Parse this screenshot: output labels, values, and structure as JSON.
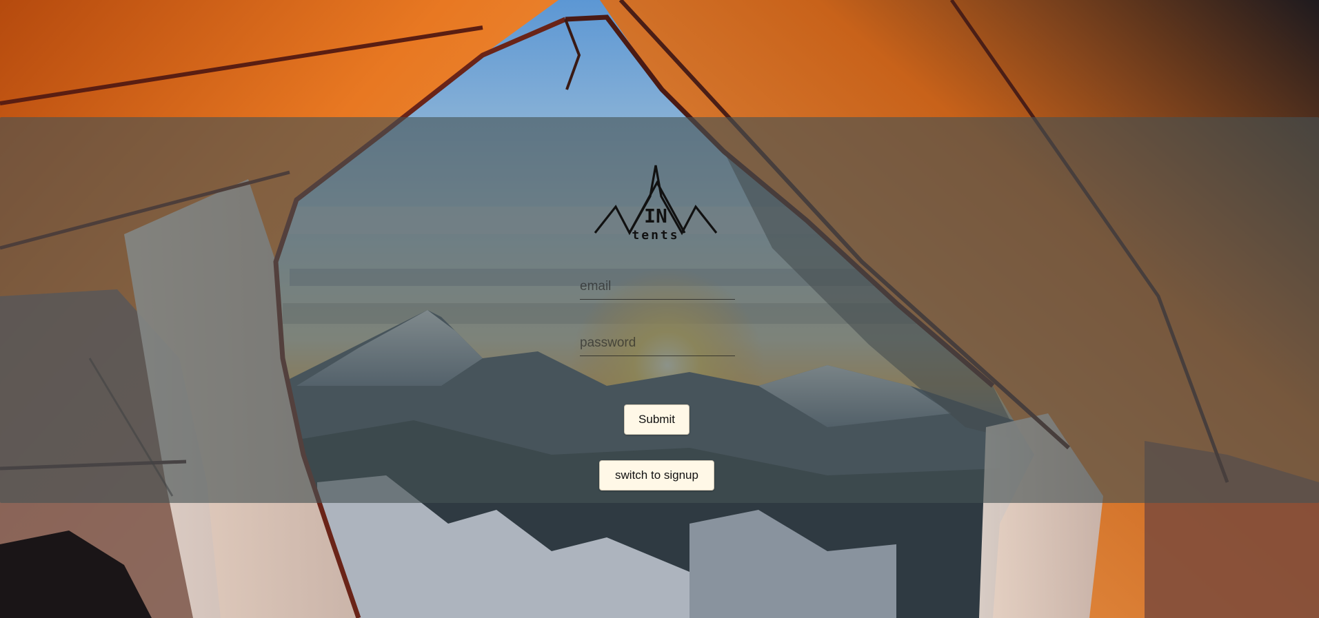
{
  "login_form": {
    "email_placeholder": "email",
    "password_placeholder": "password",
    "submit_label": "Submit",
    "switch_label": "switch to signup"
  },
  "logo": {
    "text_main": "IN",
    "text_sub": "tents"
  },
  "colors": {
    "overlay": "#465254",
    "button_bg": "#fff8e7",
    "tent_orange": "#d9641a",
    "sky_blue": "#6aa2d6"
  },
  "icons": {
    "logo": "mountain-tent-logo"
  }
}
